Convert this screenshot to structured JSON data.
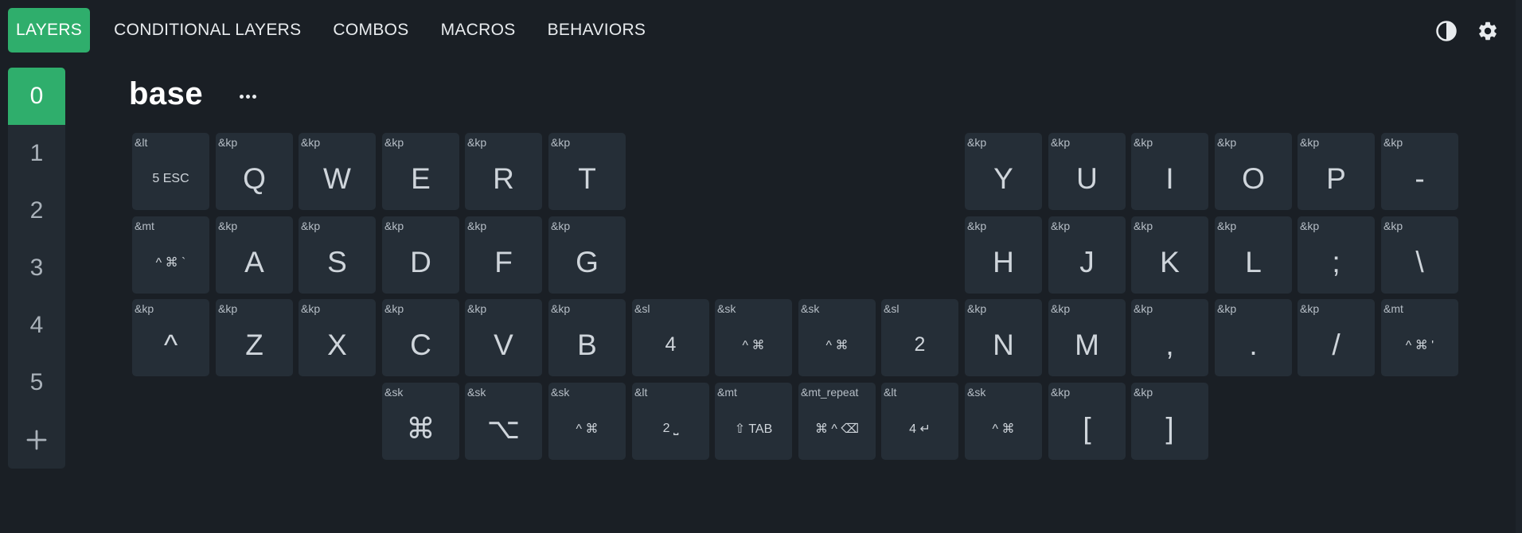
{
  "nav": {
    "tabs": [
      {
        "label": "LAYERS"
      },
      {
        "label": "CONDITIONAL LAYERS"
      },
      {
        "label": "COMBOS"
      },
      {
        "label": "MACROS"
      },
      {
        "label": "BEHAVIORS"
      }
    ],
    "active_tab": 0
  },
  "icons": {
    "theme": "contrast-icon",
    "settings": "gear-icon",
    "add": "plus-icon",
    "more": "ellipsis-icon"
  },
  "colors": {
    "accent": "#2fae6c",
    "background": "#1a1f25",
    "key": "#252e37"
  },
  "layers": {
    "items": [
      "0",
      "1",
      "2",
      "3",
      "4",
      "5"
    ],
    "active": 0
  },
  "layer": {
    "name": "base"
  },
  "keys": [
    {
      "behavior": "&lt",
      "legend": "5 ESC",
      "size": "small"
    },
    {
      "behavior": "&kp",
      "legend": "Q"
    },
    {
      "behavior": "&kp",
      "legend": "W"
    },
    {
      "behavior": "&kp",
      "legend": "E"
    },
    {
      "behavior": "&kp",
      "legend": "R"
    },
    {
      "behavior": "&kp",
      "legend": "T"
    },
    {
      "behavior": "&kp",
      "legend": "Y"
    },
    {
      "behavior": "&kp",
      "legend": "U"
    },
    {
      "behavior": "&kp",
      "legend": "I"
    },
    {
      "behavior": "&kp",
      "legend": "O"
    },
    {
      "behavior": "&kp",
      "legend": "P"
    },
    {
      "behavior": "&kp",
      "legend": "-"
    },
    {
      "behavior": "&mt",
      "legend": "^ ⌘ `",
      "size": "small"
    },
    {
      "behavior": "&kp",
      "legend": "A"
    },
    {
      "behavior": "&kp",
      "legend": "S"
    },
    {
      "behavior": "&kp",
      "legend": "D"
    },
    {
      "behavior": "&kp",
      "legend": "F"
    },
    {
      "behavior": "&kp",
      "legend": "G"
    },
    {
      "behavior": "&kp",
      "legend": "H"
    },
    {
      "behavior": "&kp",
      "legend": "J"
    },
    {
      "behavior": "&kp",
      "legend": "K"
    },
    {
      "behavior": "&kp",
      "legend": "L"
    },
    {
      "behavior": "&kp",
      "legend": ";"
    },
    {
      "behavior": "&kp",
      "legend": "\\"
    },
    {
      "behavior": "&kp",
      "legend": "^"
    },
    {
      "behavior": "&kp",
      "legend": "Z"
    },
    {
      "behavior": "&kp",
      "legend": "X"
    },
    {
      "behavior": "&kp",
      "legend": "C"
    },
    {
      "behavior": "&kp",
      "legend": "V"
    },
    {
      "behavior": "&kp",
      "legend": "B"
    },
    {
      "behavior": "&sl",
      "legend": "4",
      "size": "mid"
    },
    {
      "behavior": "&sk",
      "legend": "^ ⌘",
      "size": "small"
    },
    {
      "behavior": "&sk",
      "legend": "^ ⌘",
      "size": "small"
    },
    {
      "behavior": "&sl",
      "legend": "2",
      "size": "mid"
    },
    {
      "behavior": "&kp",
      "legend": "N"
    },
    {
      "behavior": "&kp",
      "legend": "M"
    },
    {
      "behavior": "&kp",
      "legend": ","
    },
    {
      "behavior": "&kp",
      "legend": "."
    },
    {
      "behavior": "&kp",
      "legend": "/"
    },
    {
      "behavior": "&mt",
      "legend": "^ ⌘ '",
      "size": "small"
    },
    {
      "behavior": "&sk",
      "legend": "⌘",
      "size": "sym"
    },
    {
      "behavior": "&sk",
      "legend": "⌥",
      "size": "sym"
    },
    {
      "behavior": "&sk",
      "legend": "^ ⌘",
      "size": "small"
    },
    {
      "behavior": "&lt",
      "legend": "2 ⎵",
      "size": "small"
    },
    {
      "behavior": "&mt",
      "legend": "⇧ TAB",
      "size": "small"
    },
    {
      "behavior": "&mt_repeat",
      "legend": "⌘ ^ ⌫",
      "size": "small"
    },
    {
      "behavior": "&lt",
      "legend": "4 ↵",
      "size": "small"
    },
    {
      "behavior": "&sk",
      "legend": "^ ⌘",
      "size": "small"
    },
    {
      "behavior": "&kp",
      "legend": "["
    },
    {
      "behavior": "&kp",
      "legend": "]"
    }
  ]
}
